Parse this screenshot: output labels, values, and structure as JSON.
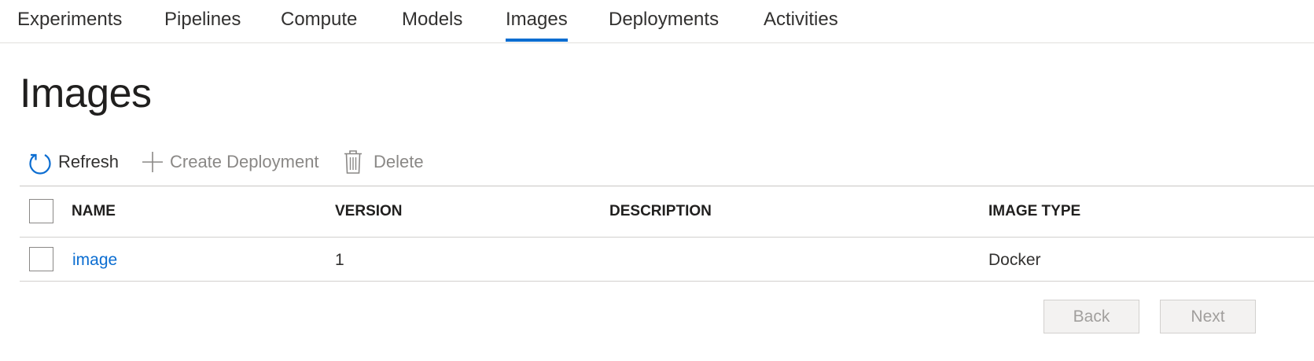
{
  "nav": {
    "tabs": [
      {
        "label": "Experiments",
        "active": false
      },
      {
        "label": "Pipelines",
        "active": false
      },
      {
        "label": "Compute",
        "active": false
      },
      {
        "label": "Models",
        "active": false
      },
      {
        "label": "Images",
        "active": true
      },
      {
        "label": "Deployments",
        "active": false
      },
      {
        "label": "Activities",
        "active": false
      }
    ],
    "accent_color": "#0b6dd1"
  },
  "page": {
    "title": "Images"
  },
  "toolbar": {
    "refresh": {
      "label": "Refresh",
      "icon": "refresh-icon",
      "enabled": true
    },
    "create_deployment": {
      "label": "Create Deployment",
      "icon": "plus-icon",
      "enabled": false
    },
    "delete": {
      "label": "Delete",
      "icon": "trash-icon",
      "enabled": false
    }
  },
  "table": {
    "columns": [
      "NAME",
      "VERSION",
      "DESCRIPTION",
      "IMAGE TYPE"
    ],
    "rows": [
      {
        "name": "image",
        "version": "1",
        "description": "",
        "image_type": "Docker"
      }
    ]
  },
  "pager": {
    "back_label": "Back",
    "next_label": "Next"
  }
}
